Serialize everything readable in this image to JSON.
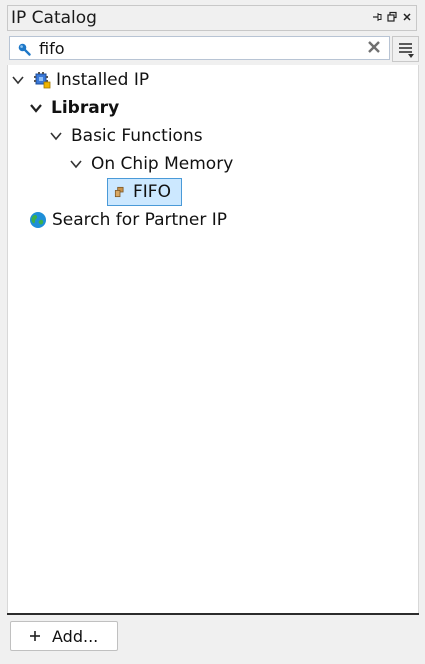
{
  "window": {
    "title": "IP Catalog"
  },
  "title_buttons": {
    "pin": "⊣",
    "float": "🗗",
    "close": "✕"
  },
  "search": {
    "value": "fifo",
    "placeholder": ""
  },
  "tree": {
    "installed": "Installed IP",
    "library": "Library",
    "basic_functions": "Basic Functions",
    "on_chip_memory": "On Chip Memory",
    "fifo": "FIFO",
    "partner": "Search for Partner IP"
  },
  "footer": {
    "add_label": "Add..."
  },
  "colors": {
    "selection": "#cce8ff",
    "selection_border": "#4a9ad8",
    "accent": "#1e78c8"
  }
}
